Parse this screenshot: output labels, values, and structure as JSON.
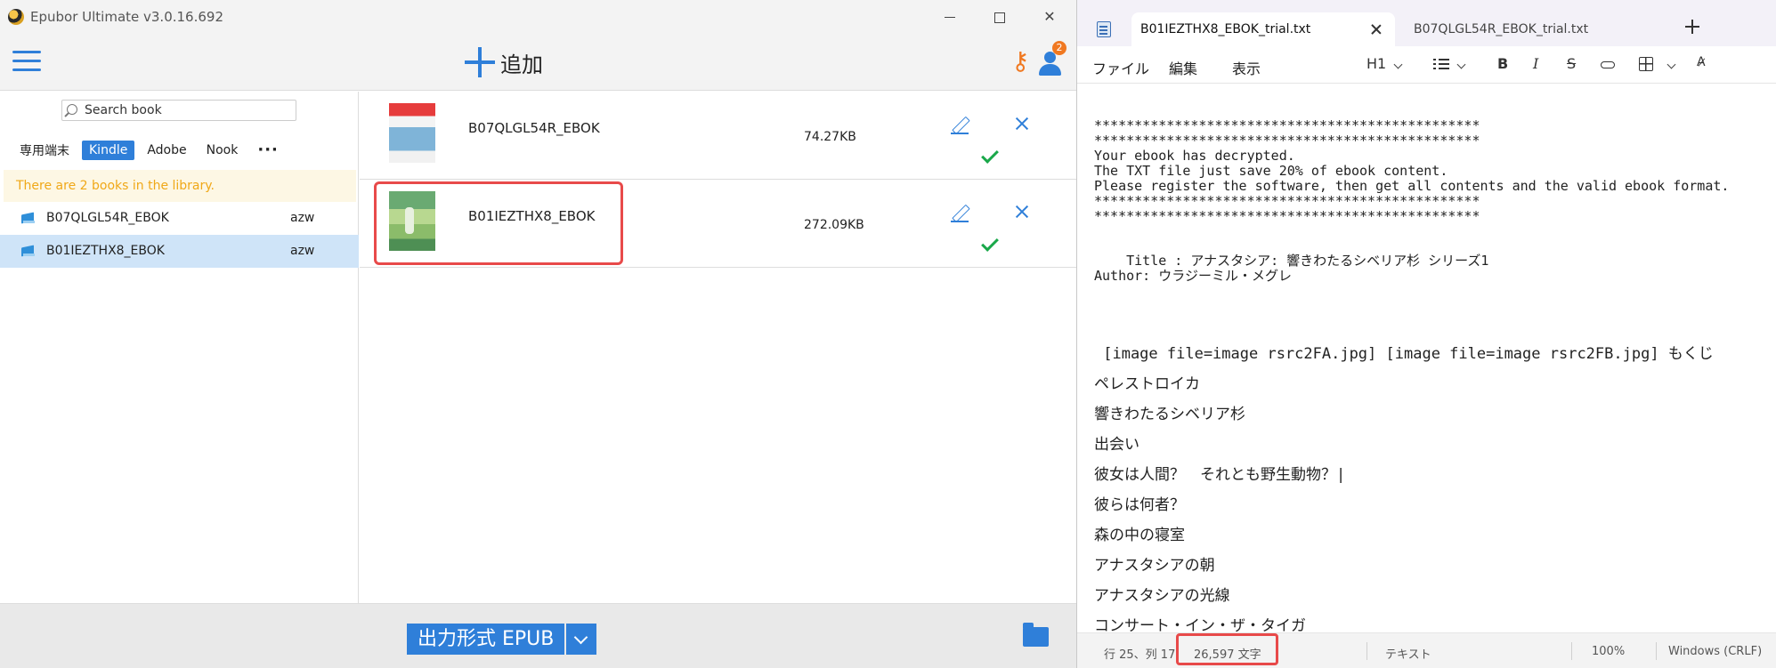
{
  "epubor": {
    "title": "Epubor Ultimate v3.0.16.692",
    "add_label": "追加",
    "user_badge": "2",
    "search_placeholder": "Search book",
    "tabs": [
      "専用端末",
      "Kindle",
      "Adobe",
      "Nook"
    ],
    "tab_more": "···",
    "active_tab": "Kindle",
    "library_notice": "There are 2 books in the library.",
    "library": [
      {
        "name": "B07QLGL54R_EBOK",
        "format": "azw"
      },
      {
        "name": "B01IEZTHX8_EBOK",
        "format": "azw"
      }
    ],
    "selected_library_item": "B01IEZTHX8_EBOK",
    "conversions": [
      {
        "name": "B07QLGL54R_EBOK",
        "size": "74.27KB"
      },
      {
        "name": "B01IEZTHX8_EBOK",
        "size": "272.09KB"
      }
    ],
    "output_format_label": "出力形式 EPUB",
    "accent_color": "#2f7fd9",
    "highlight_color": "#e84a4a"
  },
  "notepad": {
    "tabs": [
      {
        "label": "B01IEZTHX8_EBOK_trial.txt",
        "active": true
      },
      {
        "label": "B07QLGL54R_EBOK_trial.txt",
        "active": false
      }
    ],
    "menu": [
      "ファイル",
      "編集",
      "表示"
    ],
    "heading_tool": "H1",
    "lines": [
      "************************************************",
      "************************************************",
      "Your ebook has decrypted.",
      "The TXT file just save 20% of ebook content.",
      "Please register the software, then get all contents and the valid ebook format.",
      "************************************************",
      "************************************************",
      "",
      "",
      "    Title : アナスタシア: 響きわたるシベリア杉 シリーズ1",
      "Author: ウラジーミル・メグレ"
    ],
    "body_lines": [
      " [image file=image rsrc2FA.jpg] [image file=image rsrc2FB.jpg] もくじ",
      "ペレストロイカ",
      "響きわたるシベリア杉",
      "出会い",
      "彼女は人間？　それとも野生動物？|",
      "彼らは何者？",
      "森の中の寝室",
      "アナスタシアの朝",
      "アナスタシアの光線",
      "コンサート・イン・ザ・タイガ"
    ],
    "status": {
      "position": "行 25、列 17",
      "chars": "26,597 文字",
      "type": "テキスト",
      "zoom": "100%",
      "encoding": "Windows (CRLF)"
    }
  }
}
